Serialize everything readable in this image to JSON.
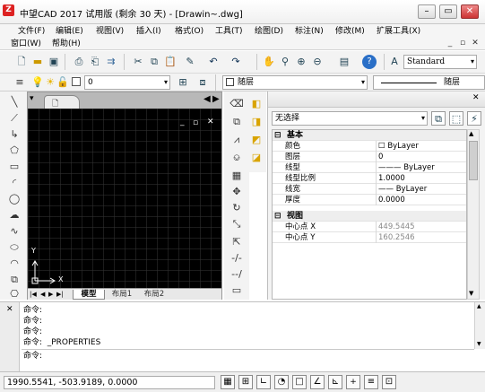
{
  "window": {
    "logo_text": "Z",
    "title": "中望CAD 2017 试用版 (剩余 30 天) - [Drawin~.dwg]",
    "minimize": "–",
    "restore": "▭",
    "close": "✕"
  },
  "menu": {
    "items": [
      "文件(F)",
      "编辑(E)",
      "视图(V)",
      "插入(I)",
      "格式(O)",
      "工具(T)",
      "绘图(D)",
      "标注(N)",
      "修改(M)",
      "扩展工具(X)"
    ],
    "row2": [
      "窗口(W)",
      "帮助(H)"
    ],
    "mdi_min": "_",
    "mdi_restore": "▫",
    "mdi_close": "✕"
  },
  "toolbar": {
    "text_style": "Standard",
    "layer_value": "0",
    "color_value": "随层",
    "linetype_value": "随层"
  },
  "drawing": {
    "canvas_min": "_",
    "canvas_restore": "▫",
    "canvas_close": "✕",
    "ucs_y": "Y",
    "ucs_x": "X",
    "tabs": [
      "模型",
      "布局1",
      "布局2"
    ]
  },
  "properties": {
    "selection": "无选择",
    "sections": [
      {
        "name": "基本",
        "toggle": "⊟",
        "rows": [
          {
            "name": "颜色",
            "value": "☐ ByLayer"
          },
          {
            "name": "图层",
            "value": "0"
          },
          {
            "name": "线型",
            "value": "——— ByLayer"
          },
          {
            "name": "线型比例",
            "value": "1.0000"
          },
          {
            "name": "线宽",
            "value": "—— ByLayer"
          },
          {
            "name": "厚度",
            "value": "0.0000"
          }
        ]
      },
      {
        "name": "视图",
        "toggle": "⊟",
        "rows": [
          {
            "name": "中心点 X",
            "value": "449.5445"
          },
          {
            "name": "中心点 Y",
            "value": "160.2546"
          }
        ]
      }
    ]
  },
  "command": {
    "close_label": "✕",
    "lines": [
      "命令:",
      "命令:",
      "命令:",
      "命令:  _PROPERTIES",
      ""
    ],
    "prompt": "命令:"
  },
  "status": {
    "coords": "1990.5541, -503.9189, 0.0000"
  },
  "colors": {
    "canvas": "#000000",
    "grid": "#323232",
    "ucs": "#ffffff",
    "accent_yellow": "#f0c000"
  }
}
